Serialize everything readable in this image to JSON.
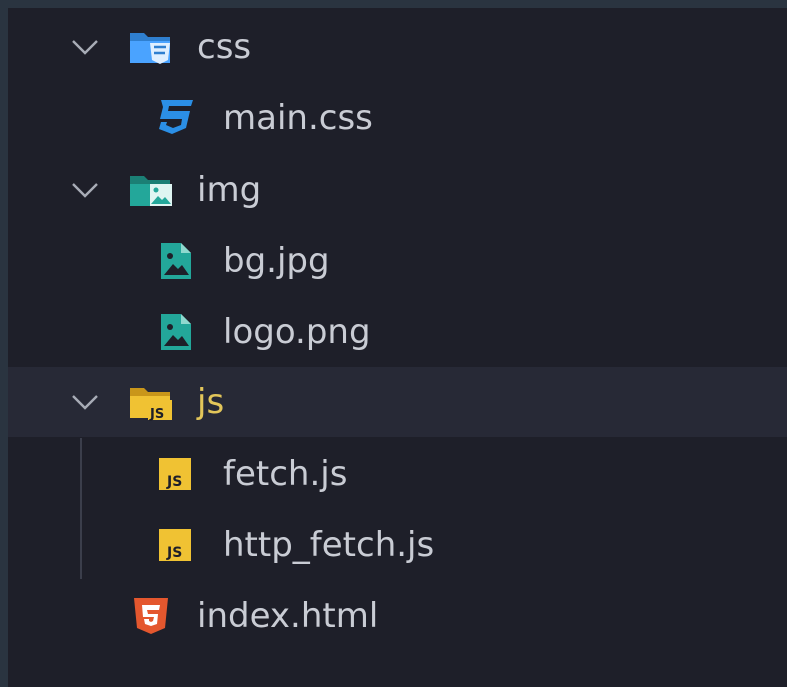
{
  "tree": {
    "folders": {
      "css": {
        "label": "css",
        "icon": "css-folder-icon",
        "expanded": true,
        "color": "#4aa3ff"
      },
      "img": {
        "label": "img",
        "icon": "image-folder-icon",
        "expanded": true,
        "color": "#23a79a"
      },
      "js": {
        "label": "js",
        "icon": "js-folder-icon",
        "expanded": true,
        "color": "#f0c233",
        "selected": true
      }
    },
    "files": {
      "main_css": {
        "label": "main.css",
        "icon": "css3-file-icon",
        "color": "#2b8fe6"
      },
      "bg_jpg": {
        "label": "bg.jpg",
        "icon": "image-file-icon",
        "color": "#23a79a"
      },
      "logo_png": {
        "label": "logo.png",
        "icon": "image-file-icon",
        "color": "#23a79a"
      },
      "fetch_js": {
        "label": "fetch.js",
        "icon": "js-file-icon",
        "color": "#f0c233"
      },
      "http_fetch_js": {
        "label": "http_fetch.js",
        "icon": "js-file-icon",
        "color": "#f0c233"
      },
      "index_html": {
        "label": "index.html",
        "icon": "html5-file-icon",
        "color": "#e4572e"
      }
    }
  }
}
